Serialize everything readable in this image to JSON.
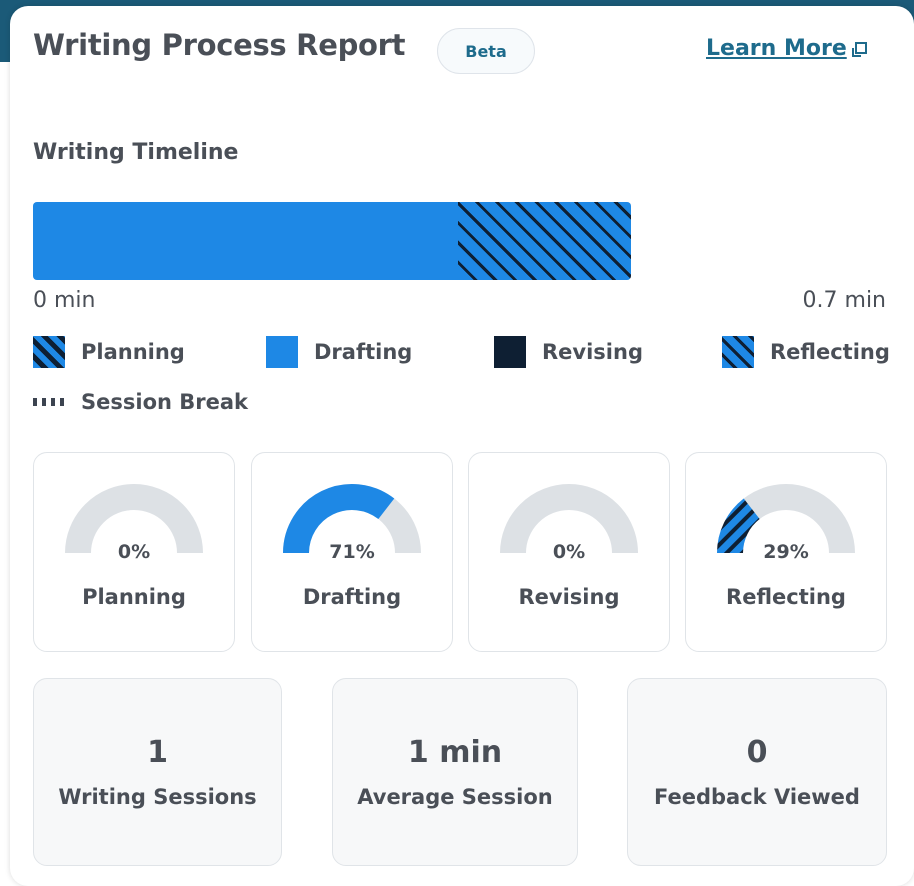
{
  "header": {
    "title": "Writing Process Report",
    "badge": "Beta",
    "learn_more": "Learn More"
  },
  "timeline": {
    "title": "Writing Timeline",
    "start_label": "0 min",
    "end_label": "0.7 min",
    "segments": [
      {
        "phase": "Drafting",
        "fraction": 0.71
      },
      {
        "phase": "Reflecting",
        "fraction": 0.29
      }
    ]
  },
  "legend": {
    "planning": "Planning",
    "drafting": "Drafting",
    "revising": "Revising",
    "reflecting": "Reflecting",
    "session_break": "Session Break"
  },
  "phases": [
    {
      "label": "Planning",
      "percent_text": "0%",
      "value": 0,
      "style": "solid"
    },
    {
      "label": "Drafting",
      "percent_text": "71%",
      "value": 71,
      "style": "solid"
    },
    {
      "label": "Revising",
      "percent_text": "0%",
      "value": 0,
      "style": "solid"
    },
    {
      "label": "Reflecting",
      "percent_text": "29%",
      "value": 29,
      "style": "striped"
    }
  ],
  "stats": [
    {
      "value": "1",
      "label": "Writing Sessions"
    },
    {
      "value": "1 min",
      "label": "Average Session"
    },
    {
      "value": "0",
      "label": "Feedback Viewed"
    }
  ],
  "colors": {
    "drafting": "#1e88e5",
    "dark": "#0e1f33",
    "track": "#dde1e5",
    "accent": "#1e6b8c",
    "text": "#4a4f57"
  },
  "icons": {
    "learn_more": "external-link-icon"
  }
}
